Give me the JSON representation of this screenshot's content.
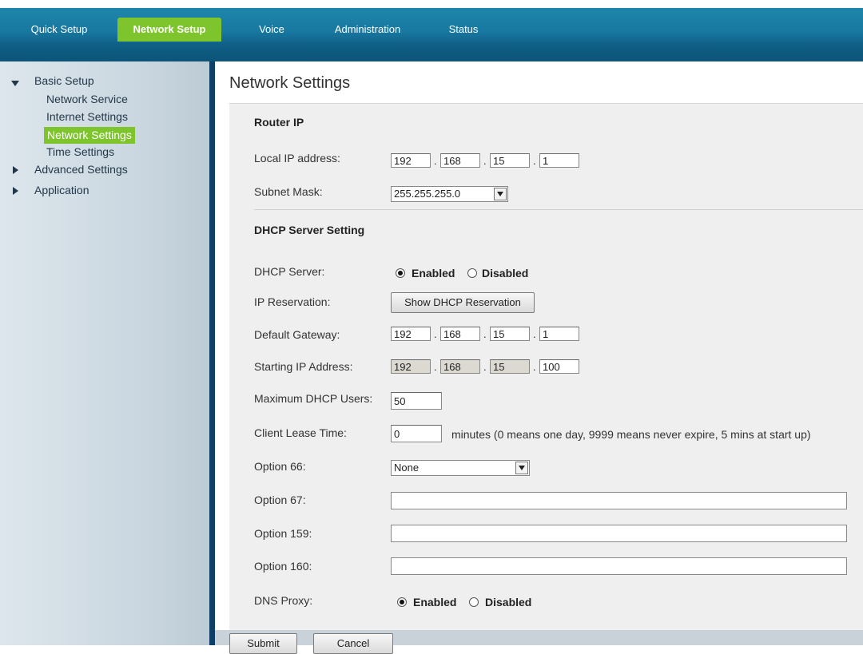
{
  "top_nav": {
    "tabs": [
      {
        "label": "Quick Setup",
        "active": false
      },
      {
        "label": "Network Setup",
        "active": true
      },
      {
        "label": "Voice",
        "active": false
      },
      {
        "label": "Administration",
        "active": false
      },
      {
        "label": "Status",
        "active": false
      }
    ]
  },
  "sidebar": {
    "basic_setup": "Basic Setup",
    "sub_items": [
      "Network Service",
      "Internet Settings",
      "Network Settings",
      "Time Settings"
    ],
    "active_sub_item": "Network Settings",
    "advanced_settings": "Advanced Settings",
    "application": "Application"
  },
  "page": {
    "title": "Network Settings"
  },
  "router_ip": {
    "section_title": "Router IP",
    "local_ip_label": "Local IP address:",
    "local_ip": [
      "192",
      "168",
      "15",
      "1"
    ],
    "subnet_label": "Subnet Mask:",
    "subnet_value": "255.255.255.0"
  },
  "dhcp": {
    "section_title": "DHCP Server Setting",
    "server_label": "DHCP Server:",
    "enabled_label": "Enabled",
    "disabled_label": "Disabled",
    "server_enabled": true,
    "reservation_label": "IP Reservation:",
    "reservation_button": "Show DHCP Reservation",
    "gateway_label": "Default Gateway:",
    "gateway": [
      "192",
      "168",
      "15",
      "1"
    ],
    "start_ip_label": "Starting IP Address:",
    "start_ip": [
      "192",
      "168",
      "15",
      "100"
    ],
    "max_users_label": "Maximum DHCP Users:",
    "max_users": "50",
    "lease_label": "Client Lease Time:",
    "lease_value": "0",
    "lease_hint": "minutes (0 means one day, 9999 means never expire, 5 mins at start up)",
    "opt66_label": "Option 66:",
    "opt66_value": "None",
    "opt67_label": "Option 67:",
    "opt159_label": "Option 159:",
    "opt160_label": "Option 160:",
    "dns_proxy_label": "DNS Proxy:",
    "dns_proxy_enabled": true
  },
  "actions": {
    "submit": "Submit",
    "cancel": "Cancel"
  },
  "colors": {
    "accent_green": "#7ec42c",
    "nav_blue": "#1878a0",
    "sidebar_border": "#0f3f66"
  }
}
